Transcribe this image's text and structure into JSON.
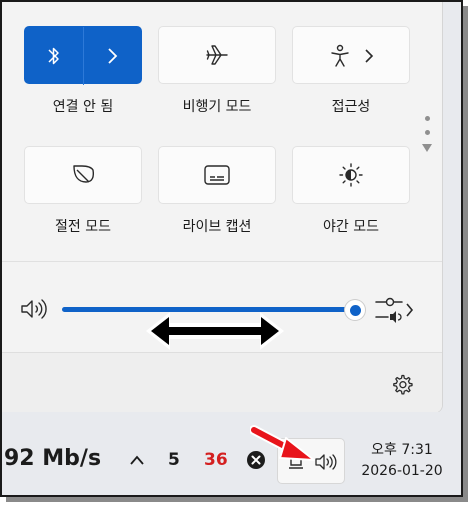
{
  "quick_settings": {
    "tiles": [
      {
        "label": "연결 안 됨",
        "icon": "bluetooth-icon",
        "active": true
      },
      {
        "label": "비행기 모드",
        "icon": "airplane-icon",
        "active": false
      },
      {
        "label": "접근성",
        "icon": "accessibility-icon",
        "active": false
      },
      {
        "label": "절전 모드",
        "icon": "leaf-icon",
        "active": false
      },
      {
        "label": "라이브 캡션",
        "icon": "captions-icon",
        "active": false
      },
      {
        "label": "야간 모드",
        "icon": "night-light-icon",
        "active": false
      }
    ],
    "volume": {
      "icon": "speaker-icon",
      "level": 1.0,
      "output_icon": "audio-output-icon"
    },
    "footer": {
      "settings_icon": "gear-icon"
    }
  },
  "taskbar": {
    "network_speed": "92 Mb/s",
    "overflow_icon": "chevron-up-icon",
    "tray_count_a": "5",
    "tray_count_b": "36",
    "tray_count_b_color": "#d42020",
    "clock": {
      "time": "오후 7:31",
      "date": "2026-01-20"
    }
  },
  "colors": {
    "accent": "#0f62c8",
    "annotation_arrow": "#e8141b"
  }
}
